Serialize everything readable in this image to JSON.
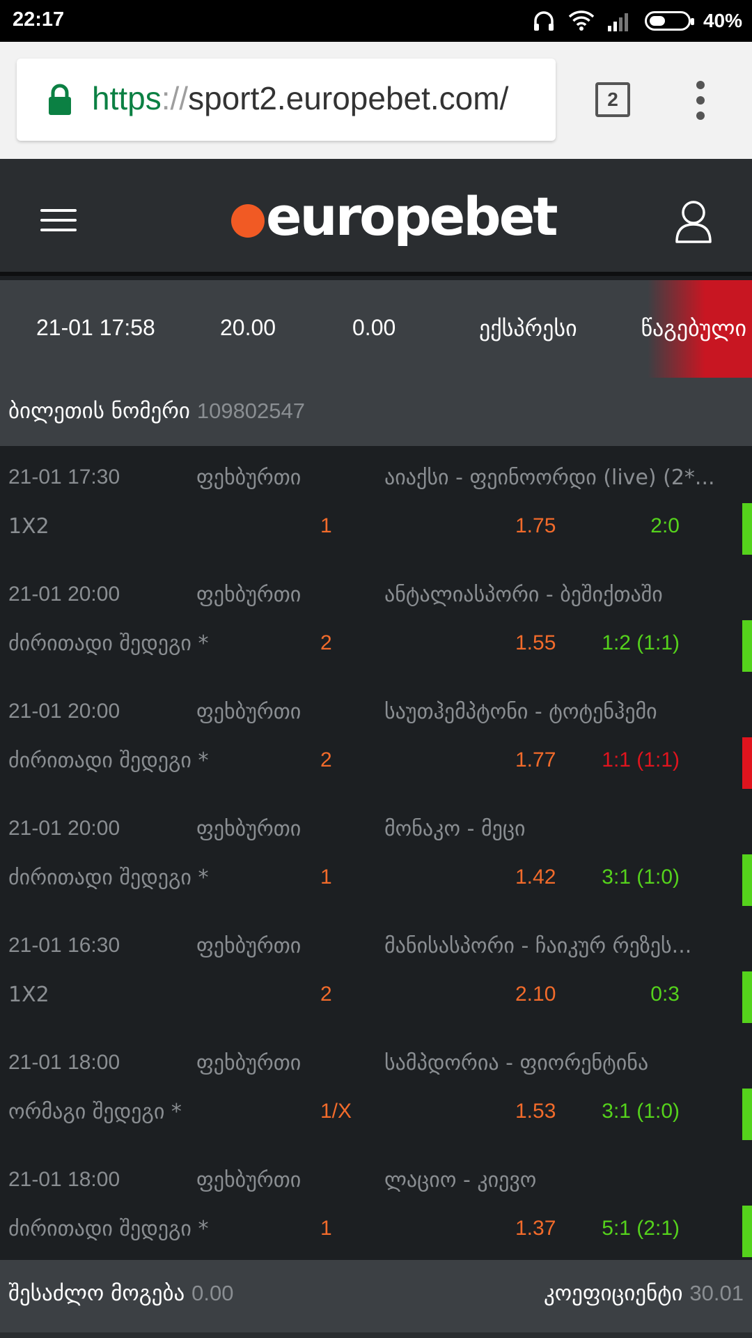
{
  "status_bar": {
    "time": "22:17",
    "battery": "40%"
  },
  "browser": {
    "url_scheme": "https",
    "url_separator": "://",
    "url_host": "sport2.europebet.com/",
    "tab_count": "2"
  },
  "header": {
    "logo_text": "europebet",
    "logo_color": "#f15a24"
  },
  "ticket": {
    "datetime": "21-01 17:58",
    "stake": "20.00",
    "payout": "0.00",
    "type": "ექსპრესი",
    "status": "წაგებული",
    "number_label": "ბილეთის ნომერი",
    "number": "109802547"
  },
  "bets": [
    {
      "date": "21-01 17:30",
      "sport": "ფეხბურთი",
      "match": "აიაქსი - ფეინოორდი (live) (2*...",
      "market": "1X2",
      "pick": "1",
      "odds": "1.75",
      "score": "2:0",
      "result": "won"
    },
    {
      "date": "21-01 20:00",
      "sport": "ფეხბურთი",
      "match": "ანტალიასპორი - ბეშიქთაში",
      "market": "ძირითადი შედეგი *",
      "pick": "2",
      "odds": "1.55",
      "score": "1:2 (1:1)",
      "result": "won"
    },
    {
      "date": "21-01 20:00",
      "sport": "ფეხბურთი",
      "match": "საუთჰემპტონი - ტოტენჰემი",
      "market": "ძირითადი შედეგი *",
      "pick": "2",
      "odds": "1.77",
      "score": "1:1 (1:1)",
      "result": "lost"
    },
    {
      "date": "21-01 20:00",
      "sport": "ფეხბურთი",
      "match": "მონაკო - მეცი",
      "market": "ძირითადი შედეგი *",
      "pick": "1",
      "odds": "1.42",
      "score": "3:1 (1:0)",
      "result": "won"
    },
    {
      "date": "21-01 16:30",
      "sport": "ფეხბურთი",
      "match": "მანისასპორი - ჩაიკურ რეზეს...",
      "market": "1X2",
      "pick": "2",
      "odds": "2.10",
      "score": "0:3",
      "result": "won"
    },
    {
      "date": "21-01 18:00",
      "sport": "ფეხბურთი",
      "match": "სამპდორია - ფიორენტინა",
      "market": "ორმაგი შედეგი *",
      "pick": "1/X",
      "odds": "1.53",
      "score": "3:1 (1:0)",
      "result": "won"
    },
    {
      "date": "21-01 18:00",
      "sport": "ფეხბურთი",
      "match": "ლაციო - კიევო",
      "market": "ძირითადი შედეგი *",
      "pick": "1",
      "odds": "1.37",
      "score": "5:1 (2:1)",
      "result": "won"
    }
  ],
  "colors": {
    "won": "#55d21c",
    "lost": "#e0141e",
    "odds": "#f26b2b"
  },
  "footer": {
    "possible_win_label": "შესაძლო მოგება",
    "possible_win_value": "0.00",
    "coef_label": "კოეფიციენტი",
    "coef_value": "30.01"
  }
}
